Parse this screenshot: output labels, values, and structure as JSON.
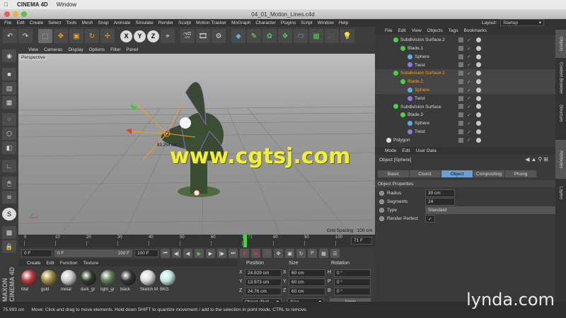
{
  "mac": {
    "app": "CINEMA 4D",
    "window": "Window"
  },
  "doc_title": "04_01_Motion_Lines.c4d",
  "menu": [
    "File",
    "Edit",
    "Create",
    "Select",
    "Tools",
    "Mesh",
    "Snap",
    "Animate",
    "Simulate",
    "Render",
    "Sculpt",
    "Motion Tracker",
    "MoGraph",
    "Character",
    "Plugins",
    "Script",
    "Window",
    "Help"
  ],
  "layout": {
    "label": "Layout:",
    "value": "Startup"
  },
  "axis_buttons": [
    "X",
    "Y",
    "Z"
  ],
  "viewport": {
    "menu": [
      "View",
      "Cameras",
      "Display",
      "Options",
      "Filter",
      "Panel"
    ],
    "label": "Perspective",
    "grid_spacing": "Grid Spacing : 100 cm",
    "measure": "83.254 cm"
  },
  "timeline": {
    "ticks": [
      "0",
      "10",
      "20",
      "30",
      "40",
      "50",
      "60",
      "70",
      "80",
      "90",
      "100"
    ],
    "current": "71",
    "end": "71 F"
  },
  "transport": {
    "start": "0 F",
    "min": "0 F",
    "max": "100 F",
    "end": "100 F"
  },
  "materials": {
    "menu": [
      "Create",
      "Edit",
      "Function",
      "Texture"
    ],
    "items": [
      {
        "name": "Mat",
        "color": "#b83a3a"
      },
      {
        "name": "gold",
        "color": "#a08a3c"
      },
      {
        "name": "metal",
        "color": "#c9c9c9"
      },
      {
        "name": "dark_gr",
        "color": "#2e3b2a"
      },
      {
        "name": "light_gr",
        "color": "#5e7a52"
      },
      {
        "name": "black",
        "color": "#333333"
      },
      {
        "name": "Sketch M",
        "color": "#d9d9d9"
      },
      {
        "name": "BKG",
        "color": "#bfe8e0"
      }
    ]
  },
  "coords": {
    "headers": [
      "Position",
      "Size",
      "Rotation"
    ],
    "rows": [
      {
        "axis": "X",
        "pos": "24.929 cm",
        "size": "60 cm",
        "rot_axis": "H",
        "rot": "0 °"
      },
      {
        "axis": "Y",
        "pos": "13.973 cm",
        "size": "60 cm",
        "rot_axis": "P",
        "rot": "0 °"
      },
      {
        "axis": "Z",
        "pos": "24.76 cm",
        "size": "60 cm",
        "rot_axis": "B",
        "rot": "0 °"
      }
    ],
    "mode": "Object (Rel)",
    "size_mode": "Size",
    "apply": "Apply"
  },
  "objects": {
    "menu": [
      "File",
      "Edit",
      "View",
      "Objects",
      "Tags",
      "Bookmarks"
    ],
    "rows": [
      {
        "name": "Subdivision Surface.2",
        "indent": 1,
        "icon": "#4ad04a",
        "sel": false
      },
      {
        "name": "Blade.1",
        "indent": 2,
        "icon": "#4ad04a",
        "sel": false
      },
      {
        "name": "Sphere",
        "indent": 3,
        "icon": "#5cb0e0",
        "sel": false
      },
      {
        "name": "Twist",
        "indent": 3,
        "icon": "#8a7ae0",
        "sel": false
      },
      {
        "name": "Subdivision Surface.1",
        "indent": 1,
        "icon": "#4ad04a",
        "sel": true
      },
      {
        "name": "Blade.2",
        "indent": 2,
        "icon": "#4ad04a",
        "sel": true
      },
      {
        "name": "Sphere",
        "indent": 3,
        "icon": "#5cb0e0",
        "sel": true
      },
      {
        "name": "Twist",
        "indent": 3,
        "icon": "#8a7ae0",
        "sel": false
      },
      {
        "name": "Subdivision Surface",
        "indent": 1,
        "icon": "#4ad04a",
        "sel": false
      },
      {
        "name": "Blade.3",
        "indent": 2,
        "icon": "#4ad04a",
        "sel": false
      },
      {
        "name": "Sphere",
        "indent": 3,
        "icon": "#5cb0e0",
        "sel": false
      },
      {
        "name": "Twist",
        "indent": 3,
        "icon": "#8a7ae0",
        "sel": false
      },
      {
        "name": "Polygon",
        "indent": 0,
        "icon": "#e0e0e0",
        "sel": false
      }
    ]
  },
  "attributes": {
    "menu": [
      "Mode",
      "Edit",
      "User Data"
    ],
    "object_title": "Object [Sphere]",
    "tabs": [
      "Basic",
      "Coord.",
      "Object",
      "Compositing",
      "Phong"
    ],
    "active_tab": "Object",
    "section": "Object Properties",
    "props": [
      {
        "label": "Radius",
        "value": "30 cm"
      },
      {
        "label": "Segments",
        "value": "24"
      },
      {
        "label": "Type",
        "value": "Standard"
      },
      {
        "label": "Render Perfect",
        "value": "✓"
      }
    ]
  },
  "side_tabs": [
    "Objects",
    "Content Browser",
    "Structure",
    "Attributes",
    "Layers"
  ],
  "status": {
    "fps": "75.993 cm",
    "message": "Move: Click and drag to move elements. Hold down SHIFT to quantize movement / add to the selection in point mode, CTRL to remove."
  },
  "watermark": {
    "text": "www.cgtsj.com",
    "brand": "lynda.com"
  }
}
